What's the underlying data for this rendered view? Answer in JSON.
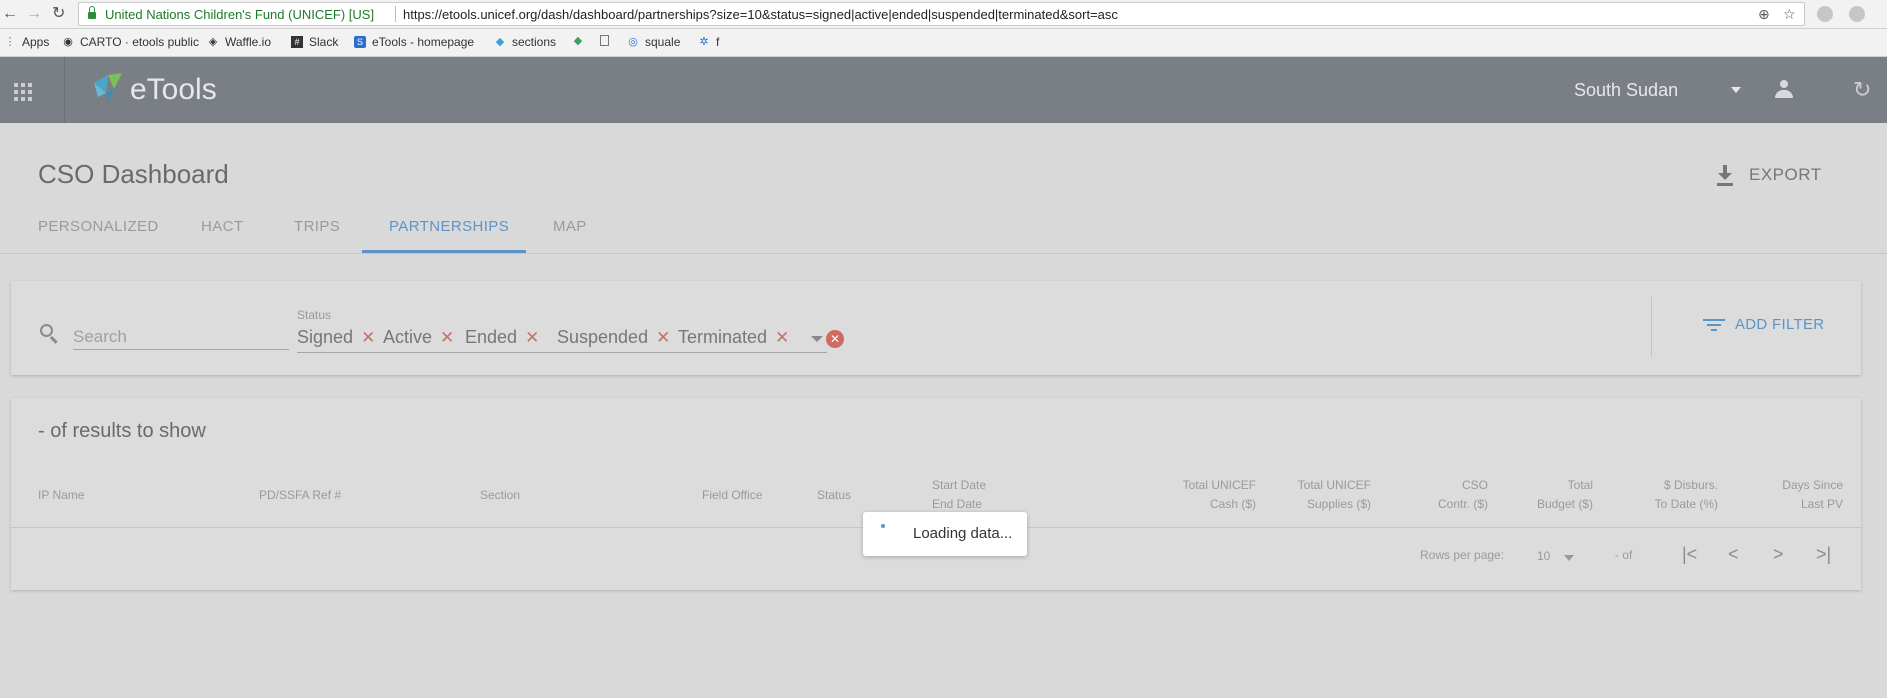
{
  "browser": {
    "nav_back": "←",
    "nav_forward": "→",
    "nav_reload": "↻",
    "secure_label": "United Nations Children's Fund (UNICEF) [US]",
    "url": "https://etools.unicef.org/dash/dashboard/partnerships?size=10&status=signed|active|ended|suspended|terminated&sort=asc"
  },
  "bookmarks": [
    {
      "label": "Apps",
      "icon": "apps-icon"
    },
    {
      "label": "CARTO · etools public",
      "icon": "carto-icon"
    },
    {
      "label": "Waffle.io",
      "icon": "waffle-icon"
    },
    {
      "label": "Slack",
      "icon": "slack-icon"
    },
    {
      "label": "eTools - homepage",
      "icon": "etools-icon"
    },
    {
      "label": "sections",
      "icon": "etools-icon"
    },
    {
      "label": "",
      "icon": "etools-icon"
    },
    {
      "label": "",
      "icon": "page-icon"
    },
    {
      "label": "squale",
      "icon": "squale-icon"
    },
    {
      "label": "f",
      "icon": "bug-icon"
    }
  ],
  "header": {
    "logo_text": "eTools",
    "country": "South Sudan"
  },
  "page": {
    "title": "CSO Dashboard",
    "export_label": "EXPORT",
    "tabs": [
      "PERSONALIZED",
      "HACT",
      "TRIPS",
      "PARTNERSHIPS",
      "MAP"
    ],
    "active_tab": "PARTNERSHIPS"
  },
  "filters": {
    "search_placeholder": "Search",
    "status_label": "Status",
    "status_chips": [
      "Signed",
      "Active",
      "Ended",
      "Suspended",
      "Terminated"
    ],
    "add_filter_label": "ADD FILTER"
  },
  "results": {
    "title": "- of results to show",
    "columns": {
      "ip_name": "IP Name",
      "ref": "PD/SSFA Ref #",
      "section": "Section",
      "field_office": "Field Office",
      "status": "Status",
      "start_date": "Start Date",
      "end_date": "End Date",
      "unicef_cash": [
        "Total UNICEF",
        "Cash ($)"
      ],
      "unicef_supplies": [
        "Total UNICEF",
        "Supplies ($)"
      ],
      "cso_contr": [
        "CSO",
        "Contr. ($)"
      ],
      "total_budget": [
        "Total",
        "Budget ($)"
      ],
      "disbursed": [
        "$ Disburs.",
        "To Date (%)"
      ],
      "days_since": [
        "Days Since",
        "Last PV"
      ]
    },
    "rows_per_page_label": "Rows per page:",
    "rows_per_page_value": "10",
    "range_text": "- of"
  },
  "loading": {
    "text": "Loading data..."
  },
  "colors": {
    "accent": "#5c94c8",
    "appbar": "#7a7f85",
    "chip_remove": "#c4736a"
  }
}
